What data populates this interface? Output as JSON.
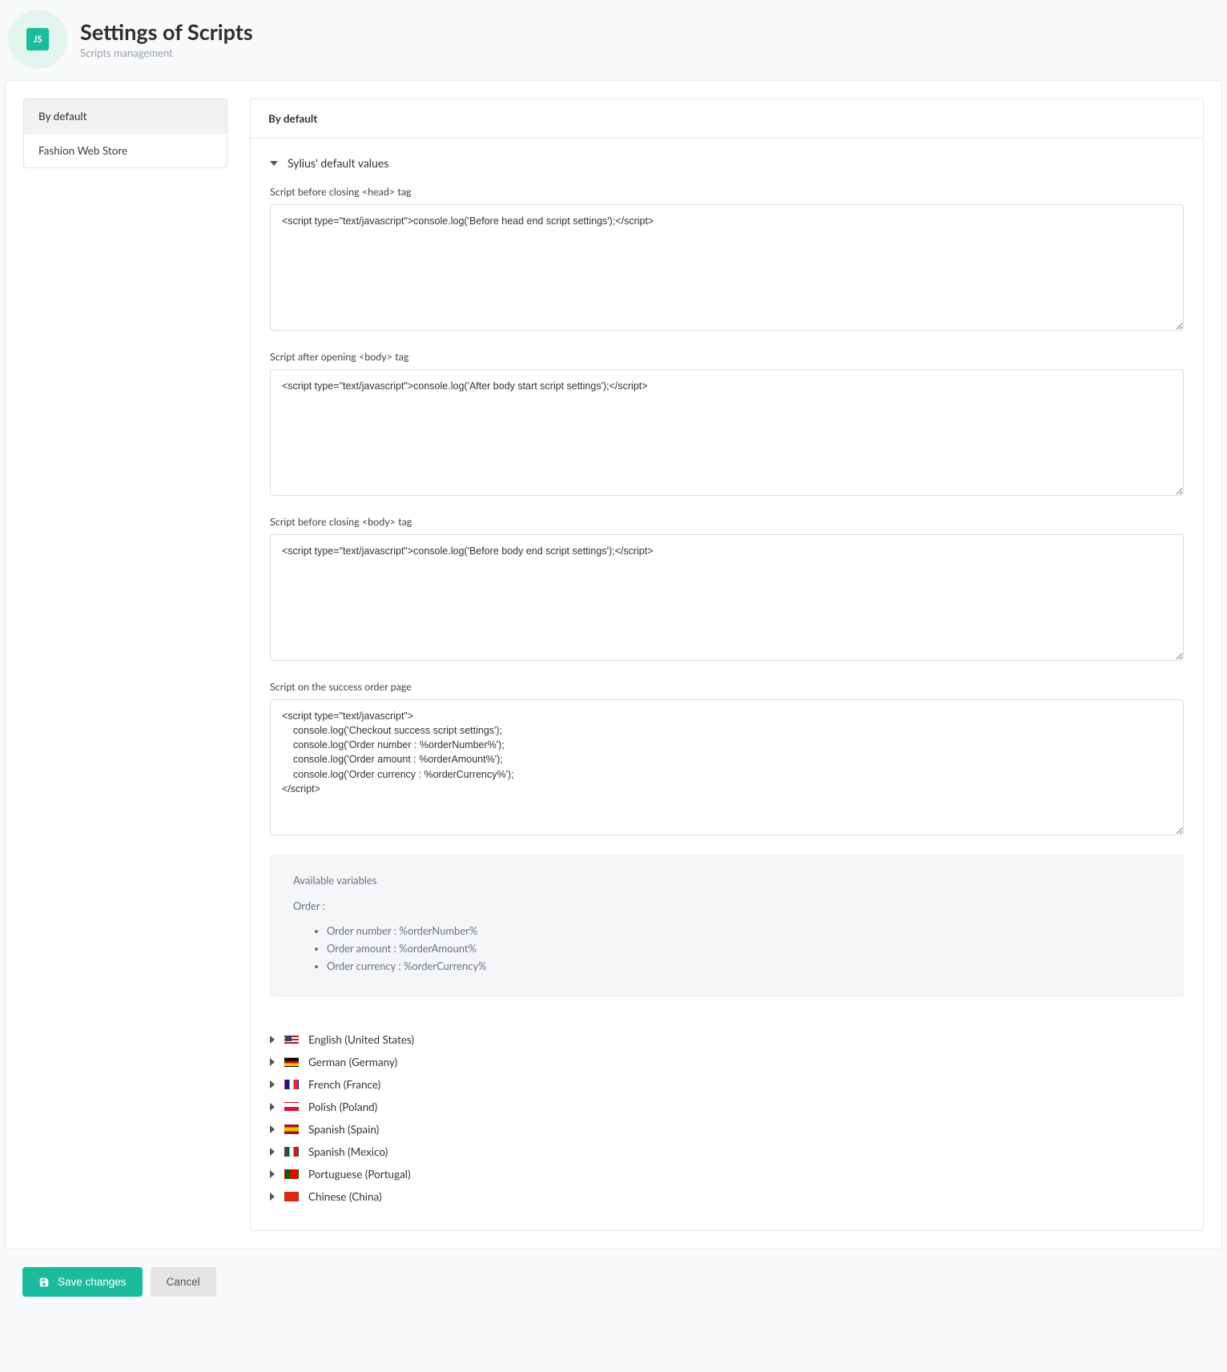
{
  "header": {
    "icon_label": "JS",
    "title": "Settings of Scripts",
    "subtitle": "Scripts management"
  },
  "sidebar": {
    "items": [
      {
        "label": "By default",
        "active": true
      },
      {
        "label": "Fashion Web Store",
        "active": false
      }
    ]
  },
  "content": {
    "title": "By default",
    "accordion_label": "Sylius' default values",
    "fields": {
      "head_end": {
        "label": "Script before closing <head> tag",
        "value": "<script type=\"text/javascript\">console.log('Before head end script settings');</script>"
      },
      "body_start": {
        "label": "Script after opening <body> tag",
        "value": "<script type=\"text/javascript\">console.log('After body start script settings');</script>"
      },
      "body_end": {
        "label": "Script before closing <body> tag",
        "value": "<script type=\"text/javascript\">console.log('Before body end script settings');</script>"
      },
      "success_order": {
        "label": "Script on the success order page",
        "value": "<script type=\"text/javascript\">\n    console.log('Checkout success script settings');\n    console.log('Order number : %orderNumber%');\n    console.log('Order amount : %orderAmount%');\n    console.log('Order currency : %orderCurrency%');\n</script>"
      }
    },
    "vars": {
      "title": "Available variables",
      "group": "Order :",
      "list": [
        "Order number : %orderNumber%",
        "Order amount : %orderAmount%",
        "Order currency : %orderCurrency%"
      ]
    },
    "languages": [
      {
        "label": "English (United States)",
        "flag": "flag-us"
      },
      {
        "label": "German (Germany)",
        "flag": "flag-de"
      },
      {
        "label": "French (France)",
        "flag": "flag-fr"
      },
      {
        "label": "Polish (Poland)",
        "flag": "flag-pl"
      },
      {
        "label": "Spanish (Spain)",
        "flag": "flag-es"
      },
      {
        "label": "Spanish (Mexico)",
        "flag": "flag-mx"
      },
      {
        "label": "Portuguese (Portugal)",
        "flag": "flag-pt"
      },
      {
        "label": "Chinese (China)",
        "flag": "flag-cn"
      }
    ]
  },
  "actions": {
    "save": "Save changes",
    "cancel": "Cancel"
  }
}
